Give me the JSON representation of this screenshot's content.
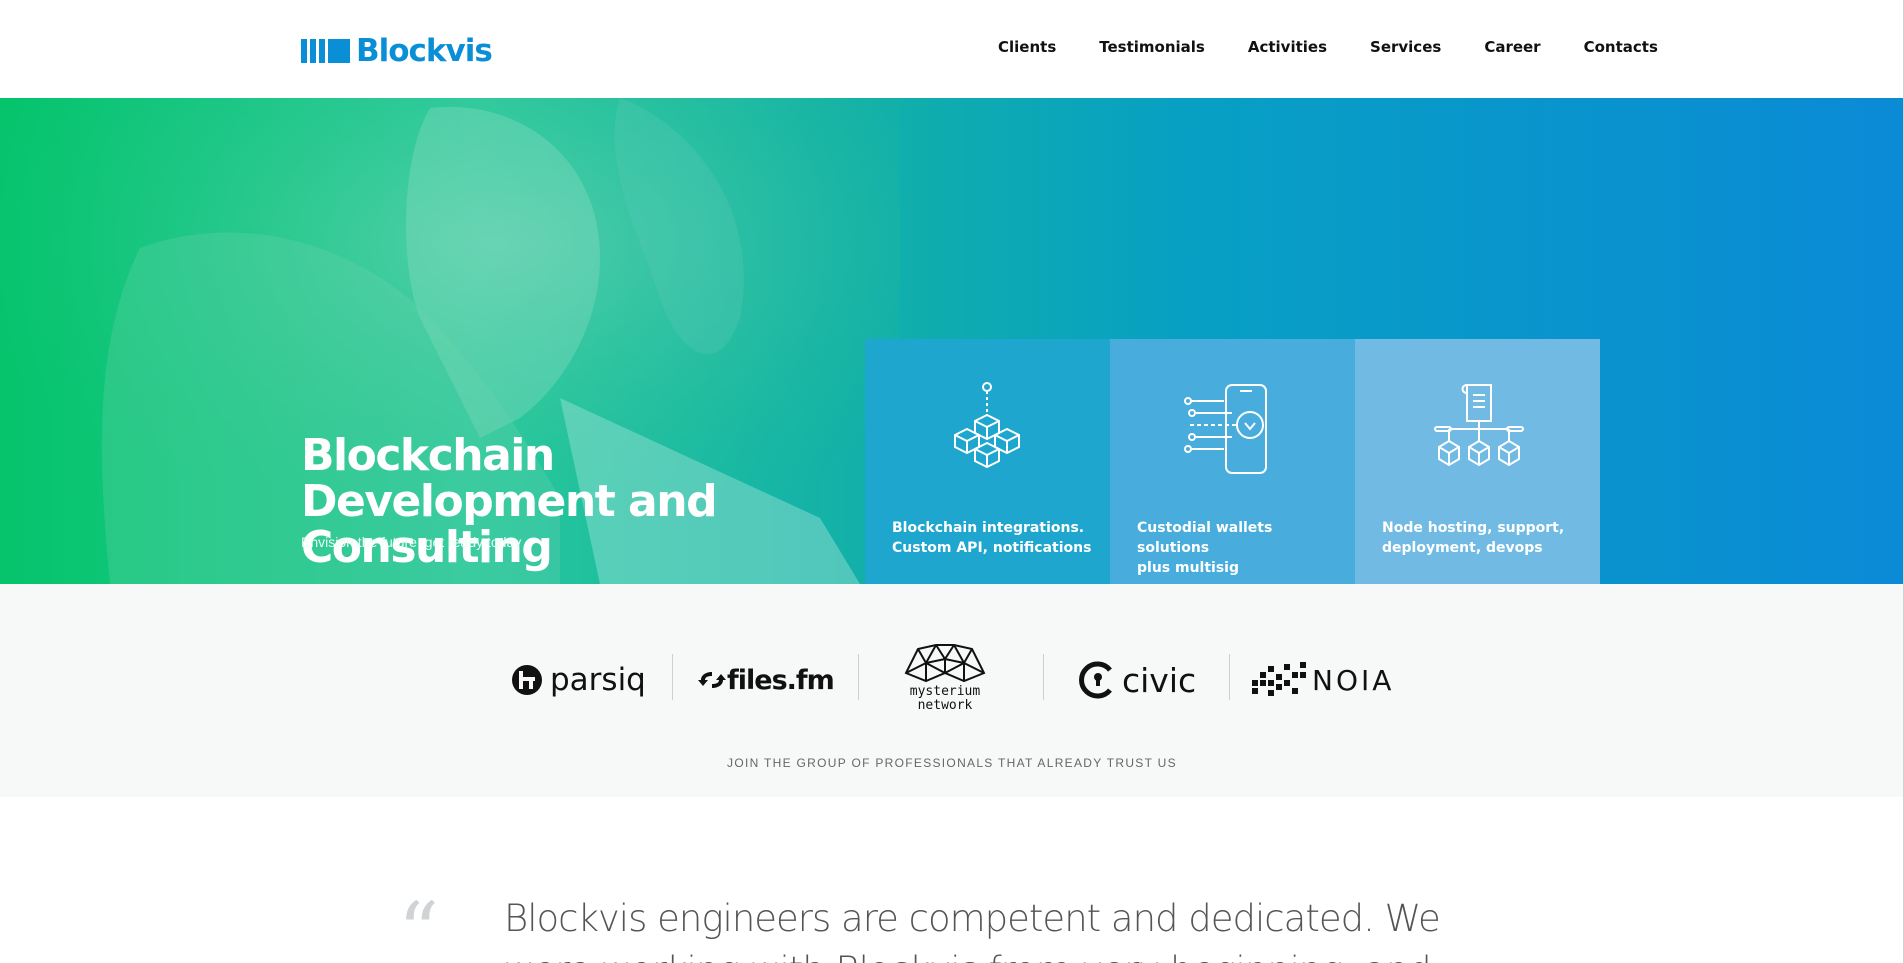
{
  "header": {
    "brand": "Blockvis",
    "nav": [
      "Clients",
      "Testimonials",
      "Activities",
      "Services",
      "Career",
      "Contacts"
    ]
  },
  "hero": {
    "title": "Blockchain Development and Consulting",
    "subtitle": "Envision the future, get ready today",
    "cards": [
      {
        "label": "Blockchain integrations.\nCustom API, notifications",
        "icon": "blockchain-cubes-icon"
      },
      {
        "label": "Custodial wallets solutions\nplus multisig",
        "icon": "mobile-wallet-icon"
      },
      {
        "label": "Node hosting, support,\ndeployment, devops",
        "icon": "node-network-icon"
      }
    ]
  },
  "clients": {
    "logos": [
      "parsiq",
      "files.fm",
      "mysterium network",
      "civic",
      "NOIA"
    ],
    "tagline": "JOIN THE GROUP OF PROFESSIONALS THAT ALREADY TRUST US"
  },
  "testimonial": {
    "quote_mark": "“",
    "text": "Blockvis engineers are competent and dedicated. We were working with Blockvis from very beginning, and"
  },
  "colors": {
    "brand": "#0a8fd6",
    "hero_green": "#05c46b",
    "hero_blue": "#0b8ad6",
    "card1": "#1ea6cf",
    "card2": "#48acdc",
    "card3": "#70bae4"
  }
}
